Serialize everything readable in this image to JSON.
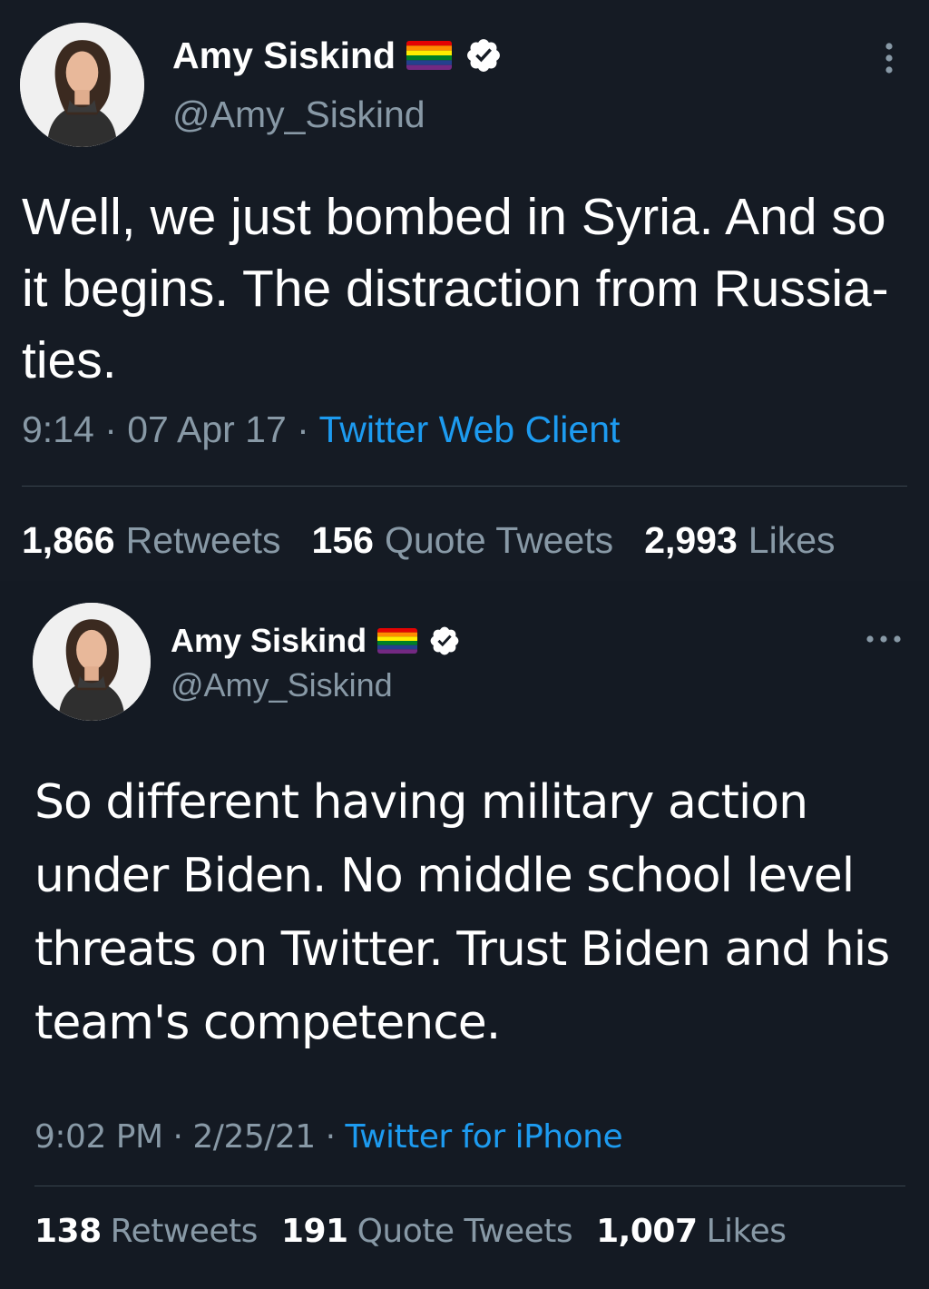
{
  "colors": {
    "background": "#151b24",
    "text_primary": "#ffffff",
    "text_secondary": "#8899a6",
    "link": "#1d9bf0",
    "divider": "#38444d"
  },
  "tweets": [
    {
      "display_name": "Amy Siskind",
      "handle": "@Amy_Siskind",
      "flag_icon": "rainbow-flag-icon",
      "verified_icon": "verified-badge-icon",
      "more_icon": "more-vertical-icon",
      "text": "Well, we just bombed in Syria. And so it begins. The distraction from Russia-ties.",
      "time": "9:14",
      "sep1": " · ",
      "date": "07 Apr 17",
      "sep2": " · ",
      "source": "Twitter Web Client",
      "stats": {
        "retweets_count": "1,866",
        "retweets_label": "Retweets",
        "quotes_count": "156",
        "quotes_label": "Quote Tweets",
        "likes_count": "2,993",
        "likes_label": "Likes"
      }
    },
    {
      "display_name": "Amy Siskind",
      "handle": "@Amy_Siskind",
      "flag_icon": "rainbow-flag-icon",
      "verified_icon": "verified-badge-icon",
      "more_icon": "more-horizontal-icon",
      "text": "So different having military action under Biden.  No middle school level threats on Twitter. Trust Biden and his team's competence.",
      "time": "9:02 PM",
      "sep1": " · ",
      "date": "2/25/21",
      "sep2": " · ",
      "source": "Twitter for iPhone",
      "stats": {
        "retweets_count": "138",
        "retweets_label": "Retweets",
        "quotes_count": "191",
        "quotes_label": "Quote Tweets",
        "likes_count": "1,007",
        "likes_label": "Likes"
      }
    }
  ]
}
